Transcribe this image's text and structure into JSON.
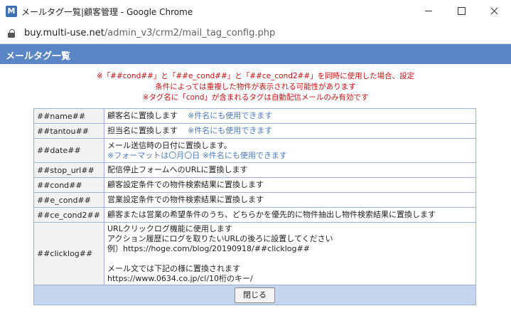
{
  "window": {
    "app_icon": "M",
    "title": "メールタグ一覧|顧客管理 - Google Chrome"
  },
  "address": {
    "host": "buy.multi-use.net",
    "path": "/admin_v3/crm2/mail_tag_config.php"
  },
  "dialog": {
    "title": "メールタグ一覧"
  },
  "notes": [
    "※「##cond##」と「##e_cond##」と「##ce_cond2##」を同時に使用した場合、設定",
    "条件によっては重複した物件が表示される可能性があります",
    "※タグ名に「cond」が含まれるタグは自動配信メールのみ有効です"
  ],
  "tags": [
    {
      "key": "##name##",
      "desc": "顧客名に置換します",
      "note": "※件名にも使用できます"
    },
    {
      "key": "##tantou##",
      "desc": "担当名に置換します",
      "note": "※件名にも使用できます"
    },
    {
      "key": "##date##",
      "desc": "メール送信時の日付に置換します。",
      "note": "※フォーマットは〇月〇日 ※件名にも使用できます"
    },
    {
      "key": "##stop_url##",
      "desc": "配信停止フォームへのURLに置換します"
    },
    {
      "key": "##cond##",
      "desc": "顧客設定条件での物件検索結果に置換します"
    },
    {
      "key": "##e_cond##",
      "desc": "営業設定条件での物件検索結果に置換します"
    },
    {
      "key": "##ce_cond2##",
      "desc": "顧客または営業の希望条件のうち、どちらかを優先的に物件抽出し物件検索結果に置換します"
    },
    {
      "key": "##clicklog##",
      "lines": [
        "URLクリックログ機能に使用します",
        "アクション履歴にログを取りたいURLの後ろに設置してください",
        "例）https://hoge.com/blog/20190918/##clicklog##",
        "",
        "メール文では下記の様に置換されます",
        "https://www.0634.co.jp/cl/10桁のキー/"
      ]
    }
  ],
  "buttons": {
    "close": "閉じる"
  },
  "icons": {
    "window_controls": [
      "minimize-icon",
      "maximize-icon",
      "close-icon"
    ],
    "address": "lock-icon"
  }
}
